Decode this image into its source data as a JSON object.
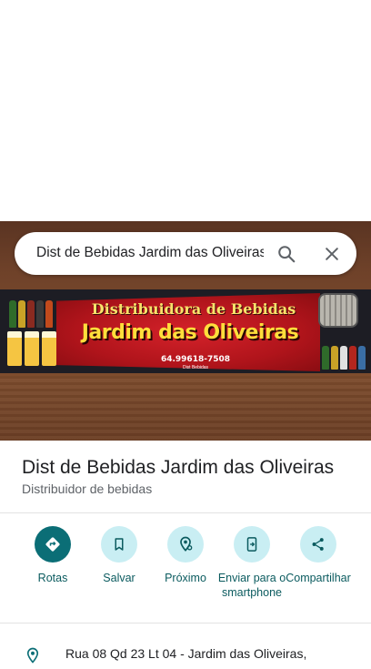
{
  "search": {
    "query": "Dist de Bebidas Jardim das Oliveiras"
  },
  "banner": {
    "line1": "Distribuidora de Bebidas",
    "line2": "Jardim das Oliveiras",
    "phone": "64.99618-7508",
    "tag": "Dist Bebidas"
  },
  "place": {
    "name": "Dist de Bebidas Jardim das Oliveiras",
    "category": "Distribuidor de bebidas"
  },
  "actions": [
    {
      "label": "Rotas",
      "icon": "directions-icon"
    },
    {
      "label": "Salvar",
      "icon": "bookmark-icon"
    },
    {
      "label": "Próximo",
      "icon": "nearby-icon"
    },
    {
      "label": "Enviar para o smartphone",
      "icon": "send-to-phone-icon"
    },
    {
      "label": "Compartilhar",
      "icon": "share-icon"
    }
  ],
  "address": {
    "text": "Rua 08 Qd 23 Lt 04 - Jardim das Oliveiras,"
  },
  "colors": {
    "accent": "#0b6e76",
    "action_bg": "#c9eef3",
    "icon": "#0b5b5f"
  }
}
